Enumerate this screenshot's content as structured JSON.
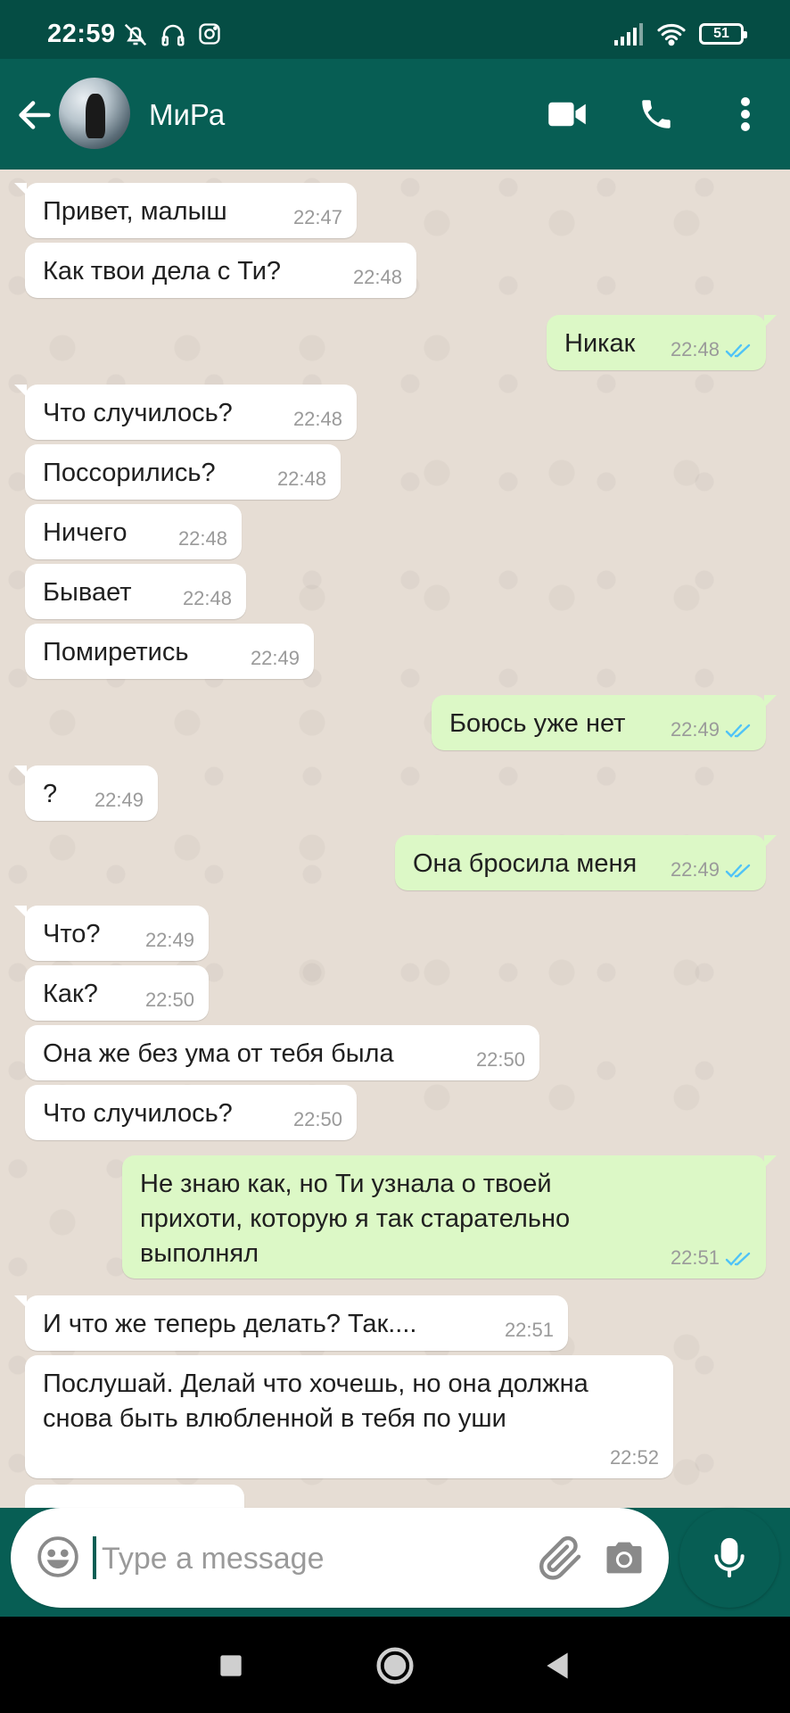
{
  "status_bar": {
    "time": "22:59",
    "battery": "51"
  },
  "header": {
    "contact_name": "МиРа"
  },
  "messages": [
    {
      "dir": "in",
      "text": "Привет, малыш",
      "time": "22:47"
    },
    {
      "dir": "in",
      "text": "Как твои дела с Ти?",
      "time": "22:48"
    },
    {
      "dir": "out",
      "text": "Никак",
      "time": "22:48",
      "status": "read"
    },
    {
      "dir": "in",
      "text": "Что случилось?",
      "time": "22:48"
    },
    {
      "dir": "in",
      "text": "Поссорились?",
      "time": "22:48"
    },
    {
      "dir": "in",
      "text": "Ничего",
      "time": "22:48"
    },
    {
      "dir": "in",
      "text": "Бывает",
      "time": "22:48"
    },
    {
      "dir": "in",
      "text": "Помиретись",
      "time": "22:49"
    },
    {
      "dir": "out",
      "text": "Боюсь уже нет",
      "time": "22:49",
      "status": "read"
    },
    {
      "dir": "in",
      "text": "?",
      "time": "22:49"
    },
    {
      "dir": "out",
      "text": "Она бросила меня",
      "time": "22:49",
      "status": "read"
    },
    {
      "dir": "in",
      "text": "Что?",
      "time": "22:49"
    },
    {
      "dir": "in",
      "text": "Как?",
      "time": "22:50"
    },
    {
      "dir": "in",
      "text": "Она же без ума от тебя была",
      "time": "22:50"
    },
    {
      "dir": "in",
      "text": "Что случилось?",
      "time": "22:50"
    },
    {
      "dir": "out",
      "text": "Не знаю как, но Ти узнала о твоей прихоти, которую я так старательно выполнял",
      "time": "22:51",
      "status": "read"
    },
    {
      "dir": "in",
      "text": "И что же теперь делать? Так....",
      "time": "22:51"
    },
    {
      "dir": "in",
      "text": "Послушай. Делай что хочешь, но она должна снова быть влюбленной в тебя по уши",
      "time": "22:52"
    }
  ],
  "input": {
    "placeholder": "Type a message",
    "value": ""
  },
  "colors": {
    "header": "#075e54",
    "outgoing_bubble": "#dcf8c6",
    "incoming_bubble": "#ffffff",
    "read_ticks": "#4fc3f7",
    "chat_bg": "#e6ddd4"
  },
  "icons": [
    "back-arrow-icon",
    "video-call-icon",
    "phone-icon",
    "more-vert-icon",
    "emoji-icon",
    "attach-icon",
    "camera-icon",
    "mic-icon"
  ]
}
